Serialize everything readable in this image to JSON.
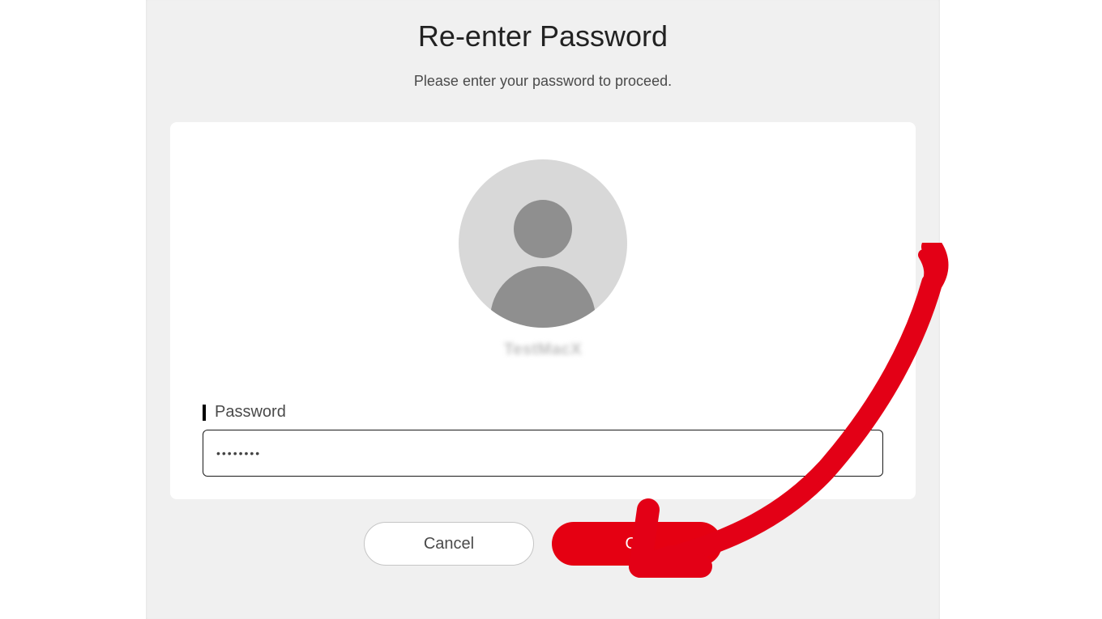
{
  "header": {
    "title": "Re-enter Password",
    "subtitle": "Please enter your password to proceed."
  },
  "card": {
    "username": "TestMacX",
    "password_label": "Password",
    "password_value": "••••••••"
  },
  "buttons": {
    "cancel": "Cancel",
    "ok": "OK"
  },
  "annotation": {
    "arrow_color": "#e30016"
  }
}
